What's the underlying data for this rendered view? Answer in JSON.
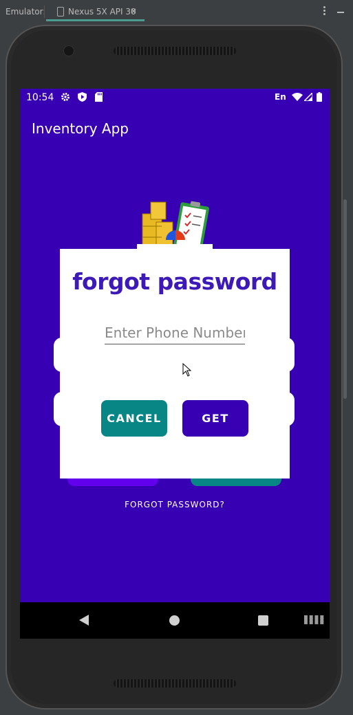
{
  "emulator": {
    "label": "Emulator:",
    "tab_name": "Nexus 5X API 30",
    "tab_close": "×"
  },
  "status_bar": {
    "time": "10:54",
    "lang": "En"
  },
  "app": {
    "title": "Inventory App",
    "forgot_link": "FORGOT PASSWORD?"
  },
  "dialog": {
    "title": "forgot password",
    "phone_placeholder": "Enter Phone Number",
    "cancel_label": "CANCEL",
    "get_label": "GET"
  },
  "colors": {
    "primary": "#3700b3",
    "teal": "#088686",
    "title": "#3d1ab8"
  },
  "icons": [
    "settings-icon",
    "shield-play-icon",
    "sd-card-icon",
    "wifi-icon",
    "signal-icon",
    "battery-icon",
    "back-icon",
    "home-icon",
    "recent-apps-icon",
    "keyboard-icon"
  ]
}
